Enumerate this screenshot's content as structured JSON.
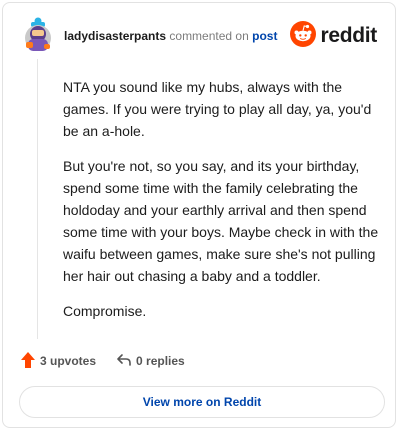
{
  "header": {
    "username": "ladydisasterpants",
    "action": "commented on",
    "post_link": "post",
    "logo_text": "reddit",
    "logo_icon": "reddit-alien-icon",
    "avatar_icon": "user-avatar"
  },
  "comment": {
    "paragraphs": [
      "NTA you sound like my hubs, always with the games. If you were trying to play all day, ya, you'd be an a-hole.",
      "But you're not, so you say, and its your birthday, spend some time with the family celebrating the holdoday and your earthly arrival and then spend some time with your boys. Maybe check in with the waifu between games, make sure she's not pulling her hair out chasing a baby and a toddler.",
      "Compromise."
    ]
  },
  "footer": {
    "upvotes": "3 upvotes",
    "upvote_icon": "upvote-arrow-icon",
    "replies": "0 replies",
    "reply_icon": "reply-icon"
  },
  "cta": {
    "label": "View more on Reddit"
  },
  "colors": {
    "brand": "#ff4500",
    "link": "#0045ac",
    "text": "#1c1c1c",
    "muted": "#7c7c7c",
    "border": "#e2e2e2"
  }
}
